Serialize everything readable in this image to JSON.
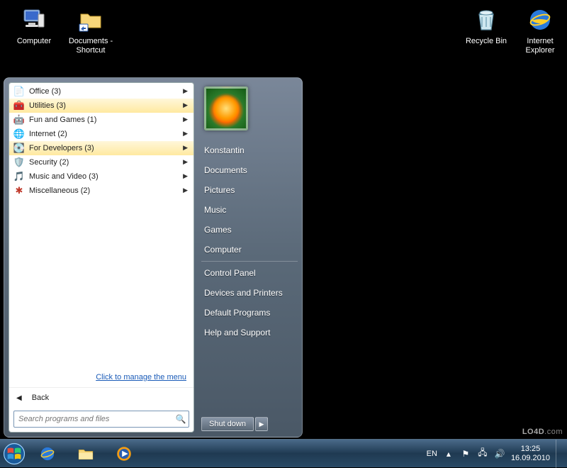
{
  "desktop": {
    "icons": [
      {
        "label": "Computer",
        "icon": "computer"
      },
      {
        "label": "Documents - Shortcut",
        "icon": "folder-shortcut"
      },
      {
        "label": "Recycle Bin",
        "icon": "recycle-bin"
      },
      {
        "label": "Internet Explorer",
        "icon": "ie"
      }
    ]
  },
  "start_menu": {
    "programs": [
      {
        "label": "Office (3)",
        "icon": "office",
        "highlight": false
      },
      {
        "label": "Utilities (3)",
        "icon": "utilities",
        "highlight": true
      },
      {
        "label": "Fun and Games (1)",
        "icon": "games",
        "highlight": false
      },
      {
        "label": "Internet (2)",
        "icon": "internet",
        "highlight": false
      },
      {
        "label": "For Developers (3)",
        "icon": "dev",
        "highlight": true
      },
      {
        "label": "Security (2)",
        "icon": "security",
        "highlight": false
      },
      {
        "label": "Music and Video (3)",
        "icon": "media",
        "highlight": false
      },
      {
        "label": "Miscellaneous (2)",
        "icon": "misc",
        "highlight": false
      }
    ],
    "manage_link": "Click to manage the menu",
    "back_label": "Back",
    "search_placeholder": "Search programs and files",
    "user_name": "Konstantin",
    "right_items_top": [
      "Documents",
      "Pictures",
      "Music",
      "Games",
      "Computer"
    ],
    "right_items_bottom": [
      "Control Panel",
      "Devices and Printers",
      "Default Programs",
      "Help and Support"
    ],
    "shutdown_label": "Shut down"
  },
  "taskbar": {
    "lang": "EN",
    "time": "13:25",
    "date": "16.09.2010"
  },
  "watermark": "LO4D.com"
}
